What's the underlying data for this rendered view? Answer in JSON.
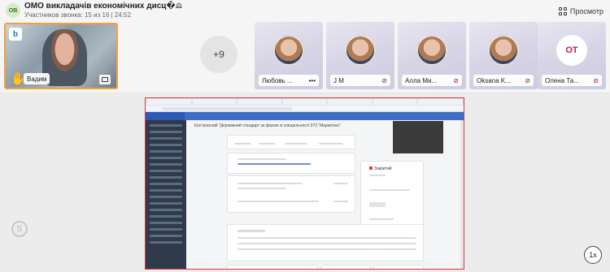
{
  "header": {
    "group_initials": "OB",
    "title": "ОМО викладачів економічних дисц�...",
    "subtitle": "Участников звонка: 15 из 16 | 24:52",
    "view_label": "Просмотр"
  },
  "participants": {
    "main": {
      "name": "Вадим",
      "badge": "b"
    },
    "more_count": "+9",
    "tiles": [
      {
        "name": "Любовь ...",
        "suffix": "•••"
      },
      {
        "name": "J M",
        "suffix": "🎙"
      },
      {
        "name": "Алла Ми...",
        "suffix": "🎙"
      },
      {
        "name": "Oksana K...",
        "suffix": "🎙"
      },
      {
        "name": "Олена Та...",
        "suffix": "🎙",
        "initials": "ОТ"
      }
    ]
  },
  "screen_share": {
    "course_title": "Кол’єкжсний “Державний стандарт за фахом зі спеціальності 073 “Маркетинг”",
    "locked_label": "Закритий",
    "zoom_label": "1x"
  },
  "colors": {
    "active_border": "#f0a23a",
    "share_border": "#d33a3a",
    "app_bar": "#3f6dc6"
  }
}
